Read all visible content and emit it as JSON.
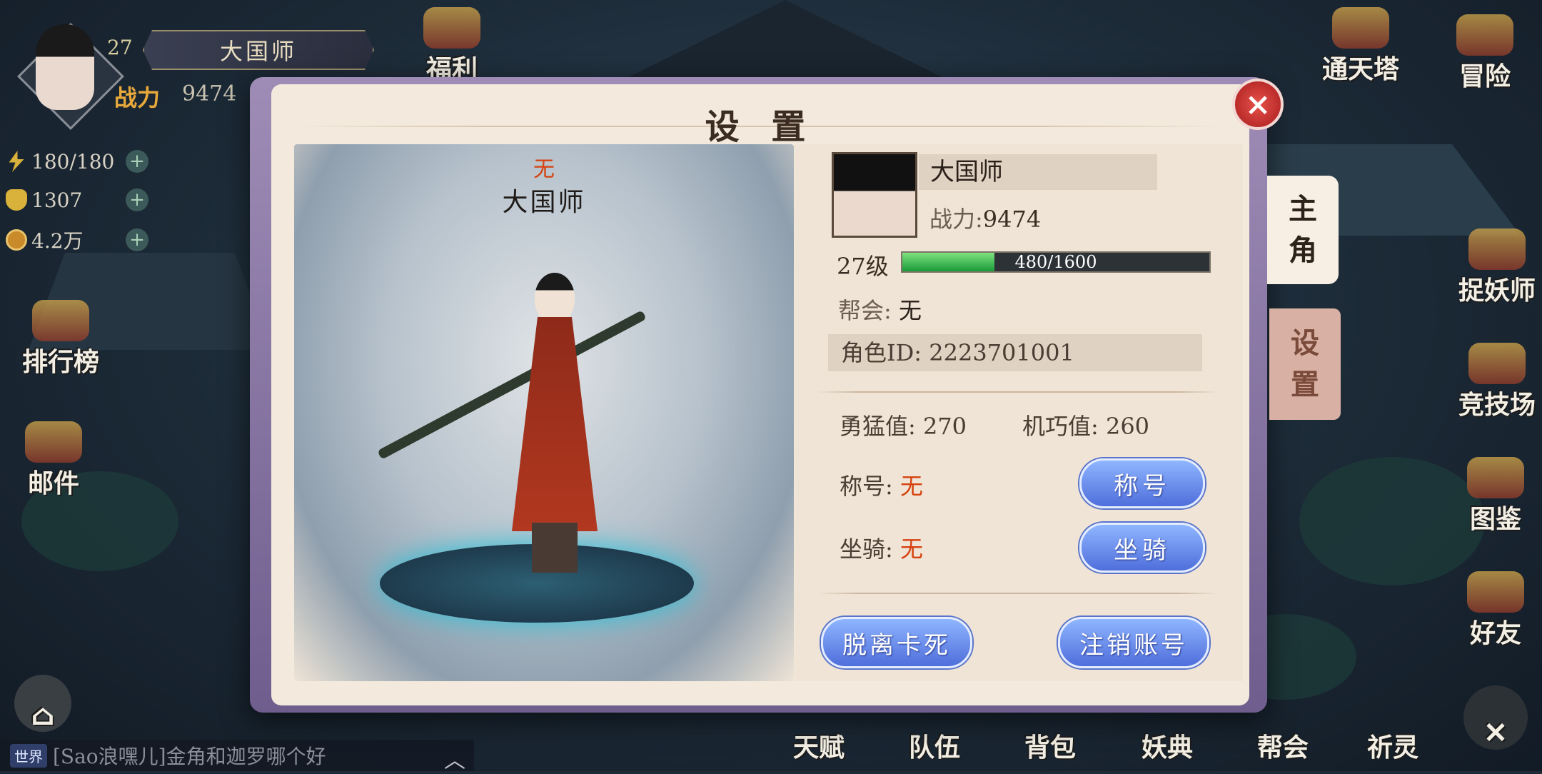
{
  "hud": {
    "level": "27",
    "name": "大国师",
    "power_label": "战力",
    "power": "9474",
    "resources": [
      {
        "icon": "lightning-icon",
        "value": "180/180"
      },
      {
        "icon": "gold-ingot-icon",
        "value": "1307"
      },
      {
        "icon": "copper-coin-icon",
        "value": "4.2万"
      }
    ]
  },
  "left_menu": [
    "福利",
    "排行榜",
    "邮件"
  ],
  "right_menu": [
    "通天塔",
    "冒险",
    "捉妖师",
    "竞技场",
    "图鉴",
    "好友"
  ],
  "bottom_menu": [
    "天赋",
    "队伍",
    "背包",
    "妖典",
    "帮会",
    "祈灵"
  ],
  "chat": {
    "channel": "世界",
    "message": "[Sao浪嘿儿]金角和迦罗哪个好"
  },
  "dialog": {
    "title": "设 置",
    "close": "×",
    "character": {
      "title": "无",
      "name": "大国师"
    },
    "profile": {
      "name": "大国师",
      "power_label": "战力:",
      "power": "9474",
      "level_label": "27级",
      "xp_text": "480/1600",
      "xp_progress": 0.3,
      "guild_label": "帮会:",
      "guild_value": "无",
      "role_id": "角色ID: 2223701001",
      "bravery": "勇猛值: 270",
      "dexterity": "机巧值: 260",
      "title_label": "称号:",
      "title_value": "无",
      "title_button": "称号",
      "mount_label": "坐骑:",
      "mount_value": "无",
      "mount_button": "坐骑"
    },
    "buttons": {
      "unstuck": "脱离卡死",
      "logout": "注销账号"
    },
    "tabs": {
      "main": [
        "主",
        "角"
      ],
      "settings": [
        "设",
        "置"
      ]
    }
  },
  "colors": {
    "accent_red": "#d6420f",
    "button_blue": "#4f6edb",
    "xp_green": "#1a9a3a"
  }
}
